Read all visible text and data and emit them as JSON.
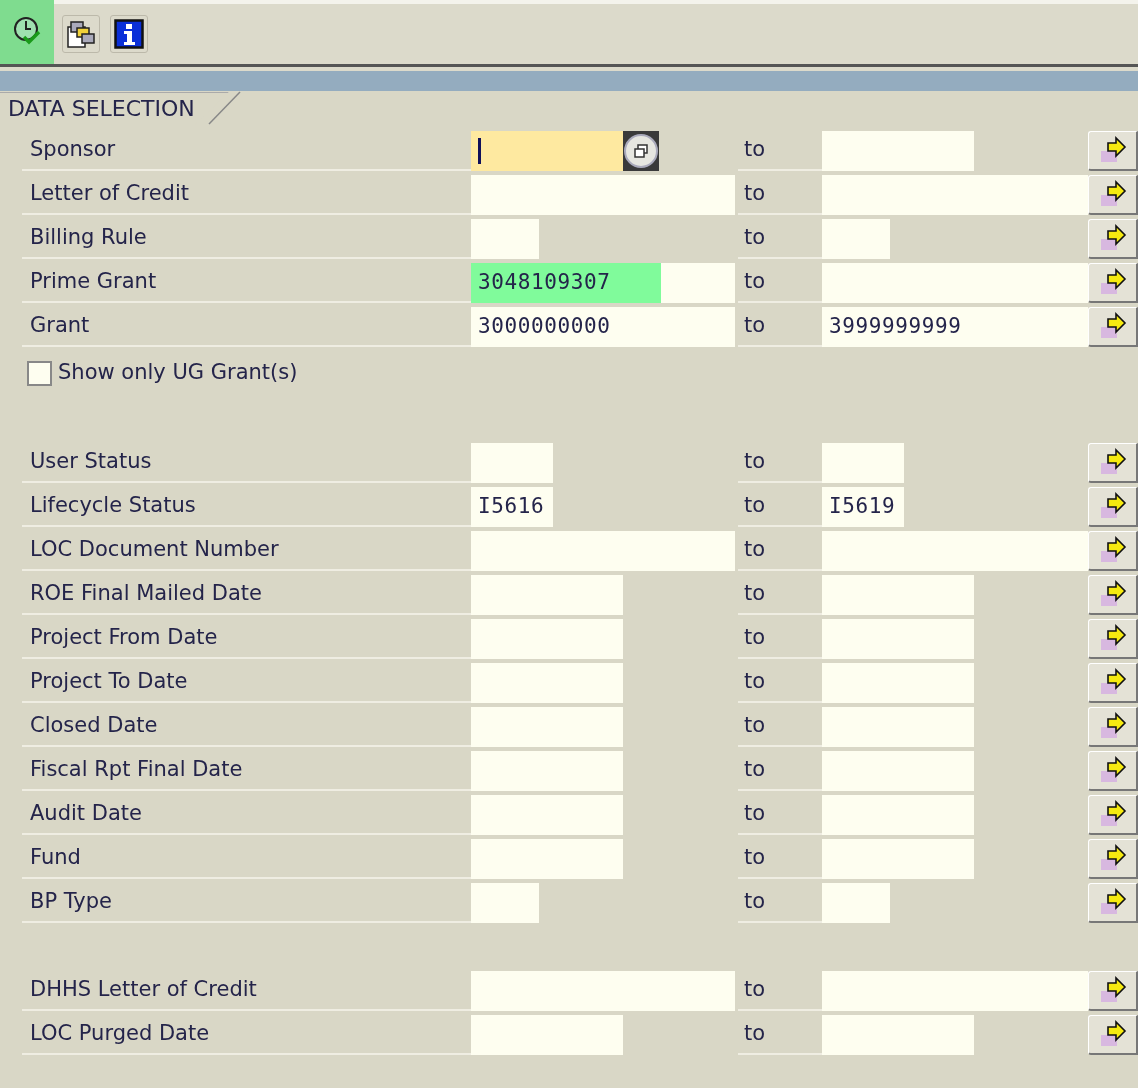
{
  "toolbar": [
    {
      "kind": "execute",
      "highlighted": true
    },
    {
      "kind": "variants",
      "highlighted": false
    },
    {
      "kind": "info",
      "highlighted": false
    }
  ],
  "tab": "DATA SELECTION",
  "sections": [
    {
      "rows": [
        {
          "label": "Sponsor",
          "kind": "lookup",
          "focused": true,
          "highlighted": false,
          "to_label": "to"
        },
        {
          "label": "Letter of Credit",
          "kind": "text",
          "focused": false,
          "highlighted": false,
          "to_label": "to"
        },
        {
          "label": "Billing Rule",
          "kind": "code",
          "focused": false,
          "highlighted": false,
          "to_label": "to"
        },
        {
          "label": "Prime Grant",
          "kind": "text",
          "focused": false,
          "highlighted": true,
          "from": "3048109307",
          "to_label": "to"
        },
        {
          "label": "Grant",
          "kind": "text",
          "focused": false,
          "highlighted": false,
          "from": "3000000000",
          "to_label": "to",
          "to": "3999999999"
        }
      ],
      "checkbox": {
        "label": "Show only UG Grant(s)",
        "checked": false
      }
    },
    {
      "rows": [
        {
          "label": "User Status",
          "kind": "status",
          "focused": false,
          "highlighted": false,
          "to_label": "to"
        },
        {
          "label": "Lifecycle Status",
          "kind": "status",
          "focused": false,
          "highlighted": false,
          "from": "I5616",
          "to_label": "to",
          "to": "I5619"
        },
        {
          "label": "LOC Document Number",
          "kind": "text",
          "focused": false,
          "highlighted": false,
          "to_label": "to"
        },
        {
          "label": "ROE Final Mailed Date",
          "kind": "date",
          "focused": false,
          "highlighted": false,
          "to_label": "to"
        },
        {
          "label": "Project From Date",
          "kind": "date",
          "focused": false,
          "highlighted": false,
          "to_label": "to"
        },
        {
          "label": "Project To Date",
          "kind": "date",
          "focused": false,
          "highlighted": false,
          "to_label": "to"
        },
        {
          "label": "Closed Date",
          "kind": "date",
          "focused": false,
          "highlighted": false,
          "to_label": "to"
        },
        {
          "label": "Fiscal Rpt Final Date",
          "kind": "date",
          "focused": false,
          "highlighted": false,
          "to_label": "to"
        },
        {
          "label": "Audit Date",
          "kind": "date",
          "focused": false,
          "highlighted": false,
          "to_label": "to"
        },
        {
          "label": "Fund",
          "kind": "date",
          "focused": false,
          "highlighted": false,
          "to_label": "to"
        },
        {
          "label": "BP Type",
          "kind": "code",
          "focused": false,
          "highlighted": false,
          "to_label": "to"
        }
      ]
    },
    {
      "rows": [
        {
          "label": "DHHS Letter of Credit",
          "kind": "text",
          "focused": false,
          "highlighted": false,
          "to_label": "to"
        },
        {
          "label": "LOC Purged Date",
          "kind": "date",
          "focused": false,
          "highlighted": false,
          "to_label": "to"
        }
      ]
    }
  ]
}
